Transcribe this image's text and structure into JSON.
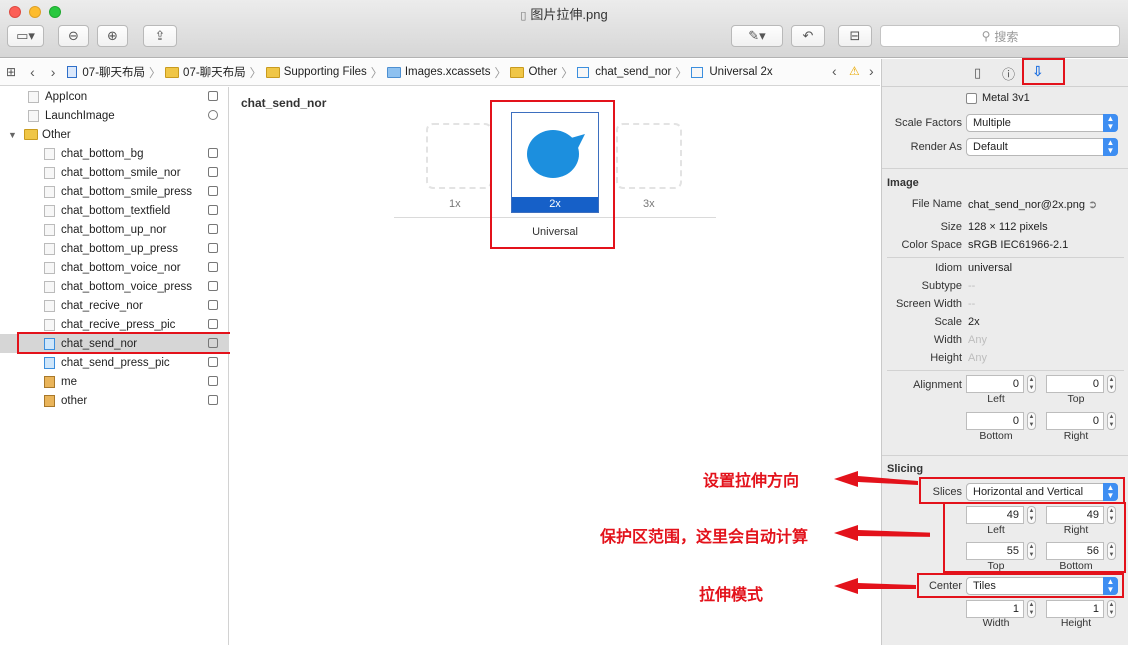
{
  "window": {
    "title": "图片拉伸.png"
  },
  "toolbar": {
    "search_placeholder": "搜索"
  },
  "breadcrumb": {
    "items": [
      "07-聊天布局",
      "07-聊天布局",
      "Supporting Files",
      "Images.xcassets",
      "Other",
      "chat_send_nor",
      "Universal 2x"
    ]
  },
  "navigator": {
    "items": [
      {
        "label": "AppIcon"
      },
      {
        "label": "LaunchImage"
      },
      {
        "label": "Other"
      },
      {
        "label": "chat_bottom_bg"
      },
      {
        "label": "chat_bottom_smile_nor"
      },
      {
        "label": "chat_bottom_smile_press"
      },
      {
        "label": "chat_bottom_textfield"
      },
      {
        "label": "chat_bottom_up_nor"
      },
      {
        "label": "chat_bottom_up_press"
      },
      {
        "label": "chat_bottom_voice_nor"
      },
      {
        "label": "chat_bottom_voice_press"
      },
      {
        "label": "chat_recive_nor"
      },
      {
        "label": "chat_recive_press_pic"
      },
      {
        "label": "chat_send_nor"
      },
      {
        "label": "chat_send_press_pic"
      },
      {
        "label": "me"
      },
      {
        "label": "other"
      }
    ],
    "selected": "chat_send_nor"
  },
  "canvas": {
    "image_set_name": "chat_send_nor",
    "slots": [
      "1x",
      "2x",
      "3x"
    ],
    "group_label": "Universal"
  },
  "inspector": {
    "metal_label": "Metal 3v1",
    "scale_factors_label": "Scale Factors",
    "scale_factors_value": "Multiple",
    "render_as_label": "Render As",
    "render_as_value": "Default",
    "image_section": "Image",
    "file_name_label": "File Name",
    "file_name_value": "chat_send_nor@2x.png",
    "size_label": "Size",
    "size_value": "128 × 112 pixels",
    "color_space_label": "Color Space",
    "color_space_value": "sRGB IEC61966-2.1",
    "idiom_label": "Idiom",
    "idiom_value": "universal",
    "subtype_label": "Subtype",
    "subtype_value": "--",
    "screen_width_label": "Screen Width",
    "screen_width_value": "--",
    "scale_label": "Scale",
    "scale_value": "2x",
    "width_label": "Width",
    "width_value": "Any",
    "height_label": "Height",
    "height_value": "Any",
    "alignment_label": "Alignment",
    "alignment": {
      "left": "0",
      "top": "0",
      "bottom": "0",
      "right": "0"
    },
    "caption_left": "Left",
    "caption_top": "Top",
    "caption_bottom": "Bottom",
    "caption_right": "Right",
    "slicing_section": "Slicing",
    "slices_label": "Slices",
    "slices_value": "Horizontal and Vertical",
    "insets": {
      "left": "49",
      "right": "49",
      "top": "55",
      "bottom": "56"
    },
    "center_label": "Center",
    "center_value": "Tiles",
    "center_size": {
      "width": "1",
      "height": "1"
    },
    "caption_width": "Width",
    "caption_height": "Height"
  },
  "annotations": {
    "slices_note": "设置拉伸方向",
    "insets_note": "保护区范围，这里会自动计算",
    "center_note": "拉伸模式"
  },
  "colors": {
    "accent": "#3e8ef2",
    "annotation": "#e3121b",
    "bubble": "#1c8fde",
    "selection": "#1660c8"
  }
}
